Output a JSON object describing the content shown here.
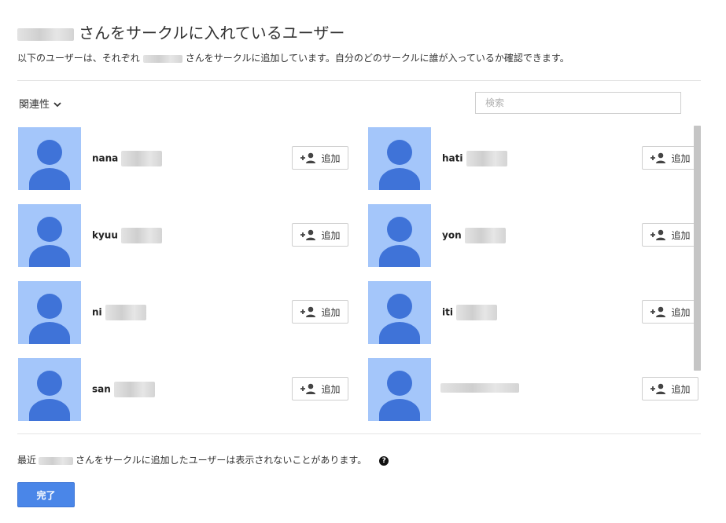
{
  "dialog": {
    "title_suffix": "さんをサークルに入れているユーザー",
    "subtitle_prefix": "以下のユーザーは、それぞれ",
    "subtitle_suffix": "さんをサークルに追加しています。自分のどのサークルに誰が入っているか確認できます。"
  },
  "toolbar": {
    "sort_label": "関連性",
    "search_placeholder": "検索"
  },
  "users": [
    {
      "name": "nana",
      "add_label": "追加"
    },
    {
      "name": "hati",
      "add_label": "追加"
    },
    {
      "name": "kyuu",
      "add_label": "追加"
    },
    {
      "name": "yon",
      "add_label": "追加"
    },
    {
      "name": "ni",
      "add_label": "追加"
    },
    {
      "name": "iti",
      "add_label": "追加"
    },
    {
      "name": "san",
      "add_label": "追加"
    },
    {
      "name": "",
      "add_label": "追加"
    }
  ],
  "footer": {
    "note_prefix": "最近",
    "note_suffix": "さんをサークルに追加したユーザーは表示されないことがあります。",
    "help_glyph": "?",
    "done_label": "完了"
  },
  "colors": {
    "avatar_bg": "#a4c6fa",
    "avatar_fg": "#3f73d8",
    "primary_button": "#4a86e8"
  }
}
